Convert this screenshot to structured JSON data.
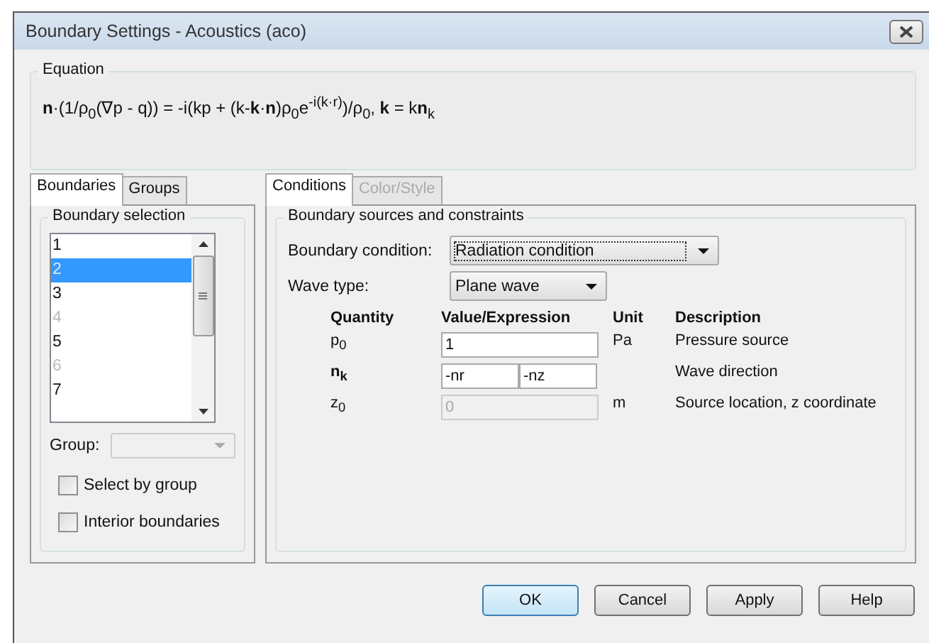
{
  "window": {
    "title": "Boundary Settings - Acoustics (aco)"
  },
  "equation": {
    "label": "Equation",
    "text": "**n**·(1/ρ$_{0}$(∇p - q)) = -i(kp + (k-**k**·**n**)ρ$_{0}$e$^{-i(k·r)}$)/ρ$_{0}$, **k** = k**n**$_{k}$"
  },
  "left_tabs": [
    {
      "label": "Boundaries",
      "selected": true
    },
    {
      "label": "Groups",
      "selected": false
    }
  ],
  "boundary_selection": {
    "label": "Boundary selection",
    "items": [
      {
        "label": "1",
        "selected": false,
        "disabled": false
      },
      {
        "label": "2",
        "selected": true,
        "disabled": false
      },
      {
        "label": "3",
        "selected": false,
        "disabled": false
      },
      {
        "label": "4",
        "selected": false,
        "disabled": true
      },
      {
        "label": "5",
        "selected": false,
        "disabled": false
      },
      {
        "label": "6",
        "selected": false,
        "disabled": true
      },
      {
        "label": "7",
        "selected": false,
        "disabled": false
      }
    ],
    "group_label": "Group:",
    "checkboxes": [
      {
        "label": "Select by group",
        "checked": false
      },
      {
        "label": "Interior boundaries",
        "checked": false
      }
    ]
  },
  "right_tabs": [
    {
      "label": "Conditions",
      "selected": true,
      "disabled": false
    },
    {
      "label": "Color/Style",
      "selected": false,
      "disabled": true
    }
  ],
  "conditions": {
    "label": "Boundary sources and constraints",
    "boundary_condition": {
      "label": "Boundary condition:",
      "value": "Radiation condition"
    },
    "wave_type": {
      "label": "Wave type:",
      "value": "Plane wave"
    },
    "columns": [
      "Quantity",
      "Value/Expression",
      "Unit",
      "Description"
    ],
    "rows": [
      {
        "quantity": "p$_{0}$",
        "bold": false,
        "values": [
          "1"
        ],
        "disabled": false,
        "unit": "Pa",
        "description": "Pressure source"
      },
      {
        "quantity": "n$_{k}$",
        "bold": true,
        "values": [
          "-nr",
          "-nz"
        ],
        "disabled": false,
        "description": "Wave direction"
      },
      {
        "quantity": "z$_{0}$",
        "bold": false,
        "values": [
          "0"
        ],
        "disabled": true,
        "unit": "m",
        "description": "Source location, z coordinate"
      }
    ]
  },
  "buttons": [
    {
      "label": "OK",
      "default": true
    },
    {
      "label": "Cancel",
      "default": false
    },
    {
      "label": "Apply",
      "default": false
    },
    {
      "label": "Help",
      "default": false
    }
  ]
}
